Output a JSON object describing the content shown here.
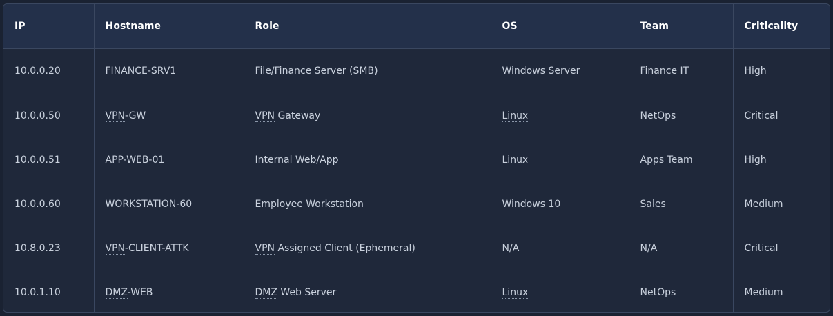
{
  "table": {
    "headers": [
      "IP",
      "Hostname",
      "Role",
      "OS",
      "Team",
      "Criticality"
    ],
    "rows": [
      {
        "ip": "10.0.0.20",
        "hostname_pre": "",
        "hostname_abbr": "",
        "hostname_post": "FINANCE-SRV1",
        "role_pre": "File/Finance Server (",
        "role_abbr": "SMB",
        "role_post": ")",
        "os_abbr": "",
        "os_text": "Windows Server",
        "team": "Finance IT",
        "criticality": "High"
      },
      {
        "ip": "10.0.0.50",
        "hostname_pre": "",
        "hostname_abbr": "VPN",
        "hostname_post": "-GW",
        "role_pre": "",
        "role_abbr": "VPN",
        "role_post": " Gateway",
        "os_abbr": "Linux",
        "os_text": "",
        "team": "NetOps",
        "criticality": "Critical"
      },
      {
        "ip": "10.0.0.51",
        "hostname_pre": "",
        "hostname_abbr": "",
        "hostname_post": "APP-WEB-01",
        "role_pre": "Internal Web/App",
        "role_abbr": "",
        "role_post": "",
        "os_abbr": "Linux",
        "os_text": "",
        "team": "Apps Team",
        "criticality": "High"
      },
      {
        "ip": "10.0.0.60",
        "hostname_pre": "",
        "hostname_abbr": "",
        "hostname_post": "WORKSTATION-60",
        "role_pre": "Employee Workstation",
        "role_abbr": "",
        "role_post": "",
        "os_abbr": "",
        "os_text": "Windows 10",
        "team": "Sales",
        "criticality": "Medium"
      },
      {
        "ip": "10.8.0.23",
        "hostname_pre": "",
        "hostname_abbr": "VPN",
        "hostname_post": "-CLIENT-ATTK",
        "role_pre": "",
        "role_abbr": "VPN",
        "role_post": " Assigned Client (Ephemeral)",
        "os_abbr": "",
        "os_text": "N/A",
        "team": "N/A",
        "criticality": "Critical"
      },
      {
        "ip": "10.0.1.10",
        "hostname_pre": "",
        "hostname_abbr": "DMZ",
        "hostname_post": "-WEB",
        "role_pre": "",
        "role_abbr": "DMZ",
        "role_post": " Web Server",
        "os_abbr": "Linux",
        "os_text": "",
        "team": "NetOps",
        "criticality": "Medium"
      }
    ]
  },
  "colors": {
    "page_bg": "#1a2232",
    "table_bg": "#1f283a",
    "header_bg": "#23304a",
    "border": "#3a4760",
    "header_text": "#ffffff",
    "cell_text": "#c9d1dd"
  }
}
